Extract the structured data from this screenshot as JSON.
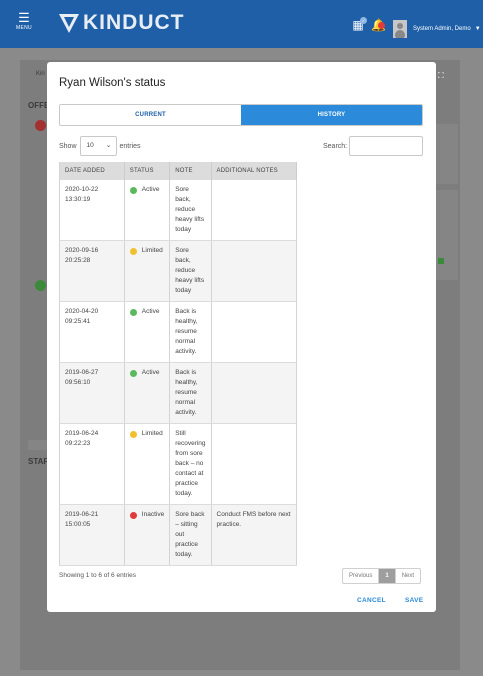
{
  "topbar": {
    "menu_label": "MENU",
    "logo_text": "KINDUCT",
    "notification_count": "",
    "user_name": "System Admin, Demo"
  },
  "background": {
    "left_labels": [
      "Kin",
      "OFFE",
      "STAF"
    ]
  },
  "modal": {
    "title": "Ryan Wilson's status",
    "tabs": [
      "CURRENT",
      "HISTORY"
    ],
    "show_label": "Show",
    "entries_value": "10",
    "entries_label": "entries",
    "search_label": "Search:",
    "search_value": "",
    "columns": [
      "DATE ADDED",
      "STATUS",
      "NOTE",
      "ADDITIONAL NOTES"
    ],
    "rows": [
      {
        "date": "2020-10-22",
        "time": "13:30:19",
        "status": "Active",
        "status_color": "#5cb85c",
        "note": "Sore back, reduce heavy lifts today",
        "additional": ""
      },
      {
        "date": "2020-09-16",
        "time": "20:25:28",
        "status": "Limited",
        "status_color": "#f0c02e",
        "note": "Sore back, reduce heavy lifts today",
        "additional": ""
      },
      {
        "date": "2020-04-20",
        "time": "09:25:41",
        "status": "Active",
        "status_color": "#5cb85c",
        "note": "Back is healthy, resume normal activity.",
        "additional": ""
      },
      {
        "date": "2019-06-27",
        "time": "09:56:10",
        "status": "Active",
        "status_color": "#5cb85c",
        "note": "Back is healthy, resume normal activity.",
        "additional": ""
      },
      {
        "date": "2019-06-24",
        "time": "09:22:23",
        "status": "Limited",
        "status_color": "#f0c02e",
        "note": "Still recovering from sore back – no contact at practice today.",
        "additional": ""
      },
      {
        "date": "2019-06-21",
        "time": "15:00:05",
        "status": "Inactive",
        "status_color": "#e03a3a",
        "note": "Sore back – sitting out practice today.",
        "additional": "Conduct FMS before next practice."
      }
    ],
    "info": "Showing 1 to 6 of 6 entries",
    "pager": {
      "previous": "Previous",
      "page": "1",
      "next": "Next"
    },
    "cancel_label": "CANCEL",
    "save_label": "SAVE"
  },
  "colors": {
    "topbar": "#1f5fa8",
    "accent": "#2b8ad9"
  }
}
